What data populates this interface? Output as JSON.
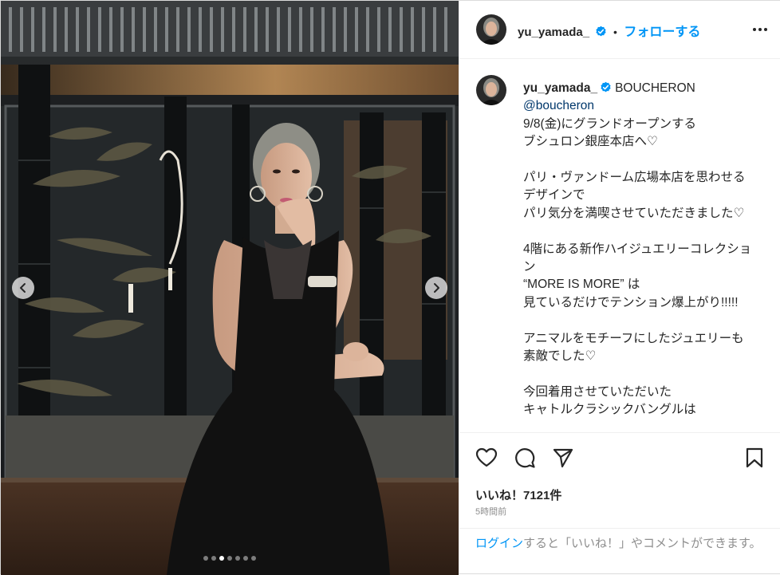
{
  "post": {
    "username": "yu_yamada_",
    "separator": "•",
    "follow_label": "フォローする",
    "caption": {
      "username": "yu_yamada_",
      "lead": "BOUCHERON",
      "mention": "@boucheron",
      "body": "9/8(金)にグランドオープンする\nブシュロン銀座本店へ♡\n\nパリ・ヴァンドーム広場本店を思わせるデザインで\nパリ気分を満喫させていただきました♡\n\n4階にある新作ハイジュエリーコレクション\n“MORE IS MORE” は\n見ているだけでテンション爆上がり!!!!!\n\nアニマルをモチーフにしたジュエリーも素敵でした♡\n\n今回着用させていただいた\nキャトルクラシックバングルは"
    },
    "likes": "いいね！7121件",
    "time_ago": "5時間前",
    "login_link": "ログイン",
    "login_rest": "すると「いいね！」やコメントができます。",
    "carousel": {
      "count": 7,
      "active": 2
    }
  },
  "icons": {
    "verified": "verified-badge-icon",
    "more": "more-options-icon",
    "like": "heart-icon",
    "comment": "comment-icon",
    "share": "paper-plane-icon",
    "save": "bookmark-icon",
    "prev": "chevron-left-icon",
    "next": "chevron-right-icon"
  },
  "colors": {
    "accent": "#0095f6",
    "mention": "#00376b",
    "muted": "#8e8e8e",
    "text": "#262626"
  }
}
